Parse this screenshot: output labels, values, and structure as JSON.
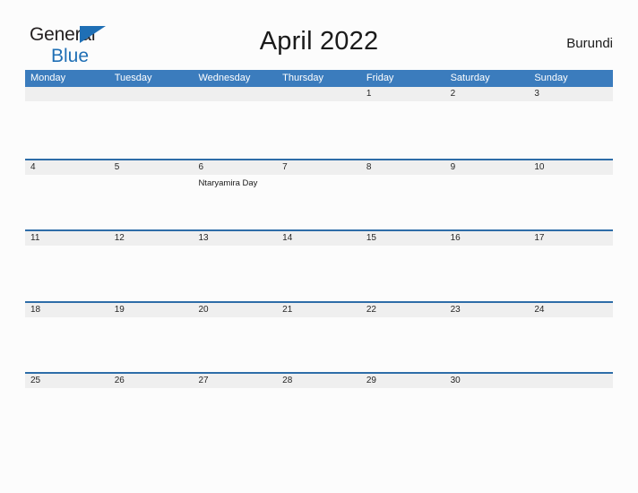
{
  "brand": {
    "line1": "General",
    "line2": "Blue",
    "flag_color": "#1f6fb5"
  },
  "header": {
    "title": "April 2022",
    "region": "Burundi",
    "accent_color": "#3b7cbd",
    "rule_color": "#2e6da8",
    "day_band_color": "#efefef"
  },
  "calendar": {
    "weekdays": [
      "Monday",
      "Tuesday",
      "Wednesday",
      "Thursday",
      "Friday",
      "Saturday",
      "Sunday"
    ],
    "weeks": [
      [
        {
          "date": "",
          "events": []
        },
        {
          "date": "",
          "events": []
        },
        {
          "date": "",
          "events": []
        },
        {
          "date": "",
          "events": []
        },
        {
          "date": "1",
          "events": []
        },
        {
          "date": "2",
          "events": []
        },
        {
          "date": "3",
          "events": []
        }
      ],
      [
        {
          "date": "4",
          "events": []
        },
        {
          "date": "5",
          "events": []
        },
        {
          "date": "6",
          "events": [
            "Ntaryamira Day"
          ]
        },
        {
          "date": "7",
          "events": []
        },
        {
          "date": "8",
          "events": []
        },
        {
          "date": "9",
          "events": []
        },
        {
          "date": "10",
          "events": []
        }
      ],
      [
        {
          "date": "11",
          "events": []
        },
        {
          "date": "12",
          "events": []
        },
        {
          "date": "13",
          "events": []
        },
        {
          "date": "14",
          "events": []
        },
        {
          "date": "15",
          "events": []
        },
        {
          "date": "16",
          "events": []
        },
        {
          "date": "17",
          "events": []
        }
      ],
      [
        {
          "date": "18",
          "events": []
        },
        {
          "date": "19",
          "events": []
        },
        {
          "date": "20",
          "events": []
        },
        {
          "date": "21",
          "events": []
        },
        {
          "date": "22",
          "events": []
        },
        {
          "date": "23",
          "events": []
        },
        {
          "date": "24",
          "events": []
        }
      ],
      [
        {
          "date": "25",
          "events": []
        },
        {
          "date": "26",
          "events": []
        },
        {
          "date": "27",
          "events": []
        },
        {
          "date": "28",
          "events": []
        },
        {
          "date": "29",
          "events": []
        },
        {
          "date": "30",
          "events": []
        },
        {
          "date": "",
          "events": []
        }
      ]
    ]
  }
}
